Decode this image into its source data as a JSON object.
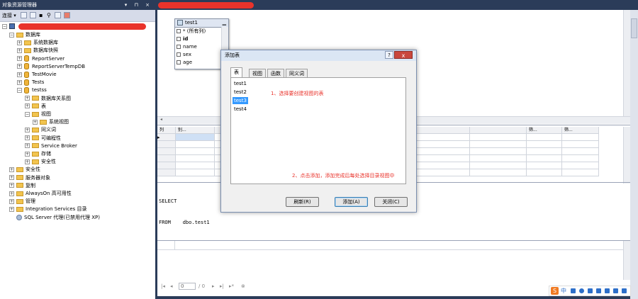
{
  "explorer": {
    "title": "对象资源管理器",
    "title_buttons": "▾ ⊓ ×",
    "connect_label": "连接 ▾",
    "tree": [
      {
        "label": "数据库",
        "icon": "folder",
        "exp": "−",
        "level": 1
      },
      {
        "label": "系统数据库",
        "icon": "folder",
        "exp": "+",
        "level": 2
      },
      {
        "label": "数据库快照",
        "icon": "folder",
        "exp": "+",
        "level": 2
      },
      {
        "label": "ReportServer",
        "icon": "db",
        "exp": "+",
        "level": 2
      },
      {
        "label": "ReportServerTempDB",
        "icon": "db",
        "exp": "+",
        "level": 2
      },
      {
        "label": "TestMovie",
        "icon": "db",
        "exp": "+",
        "level": 2
      },
      {
        "label": "Tests",
        "icon": "db",
        "exp": "+",
        "level": 2
      },
      {
        "label": "testss",
        "icon": "db",
        "exp": "−",
        "level": 2
      },
      {
        "label": "数据库关系图",
        "icon": "folder",
        "exp": "+",
        "level": 3
      },
      {
        "label": "表",
        "icon": "folder",
        "exp": "+",
        "level": 3
      },
      {
        "label": "视图",
        "icon": "folder",
        "exp": "−",
        "level": 3
      },
      {
        "label": "系统视图",
        "icon": "folder",
        "exp": "+",
        "level": 4
      },
      {
        "label": "同义词",
        "icon": "folder",
        "exp": "+",
        "level": 3
      },
      {
        "label": "可编程性",
        "icon": "folder",
        "exp": "+",
        "level": 3
      },
      {
        "label": "Service Broker",
        "icon": "folder",
        "exp": "+",
        "level": 3
      },
      {
        "label": "存储",
        "icon": "folder",
        "exp": "+",
        "level": 3
      },
      {
        "label": "安全性",
        "icon": "folder",
        "exp": "+",
        "level": 3
      },
      {
        "label": "安全性",
        "icon": "folder",
        "exp": "+",
        "level": 1
      },
      {
        "label": "服务器对象",
        "icon": "folder",
        "exp": "+",
        "level": 1
      },
      {
        "label": "复制",
        "icon": "folder",
        "exp": "+",
        "level": 1
      },
      {
        "label": "AlwaysOn 高可用性",
        "icon": "folder",
        "exp": "+",
        "level": 1
      },
      {
        "label": "管理",
        "icon": "folder",
        "exp": "+",
        "level": 1
      },
      {
        "label": "Integration Services 目录",
        "icon": "folder",
        "exp": "+",
        "level": 1
      },
      {
        "label": "SQL Server 代理(已禁用代理 XP)",
        "icon": "agent",
        "exp": "",
        "level": 1
      }
    ]
  },
  "diagram": {
    "table_name": "test1",
    "columns": [
      "* (所有列)",
      "id",
      "name",
      "sex",
      "age"
    ]
  },
  "grid": {
    "headers": [
      "列",
      "别...",
      "",
      "",
      "",
      "",
      "",
      "",
      "筛...",
      "筛..."
    ]
  },
  "sql": {
    "line1": "SELECT",
    "line2": "FROM    dbo.test1"
  },
  "nav": {
    "page_value": "0",
    "page_total": "/ 0"
  },
  "dialog": {
    "title": "添加表",
    "help": "?",
    "close": "x",
    "tabs": [
      "表",
      "视图",
      "函数",
      "同义词"
    ],
    "items": [
      "test1",
      "test2",
      "test3",
      "test4"
    ],
    "selected_index": 2,
    "annotation1": "1、选择要创建视图的表",
    "annotation2": "2、点击添加，添加完成后每处选择目录视图中",
    "buttons": {
      "refresh": "刷新(R)",
      "add": "添加(A)",
      "close": "关闭(C)"
    }
  },
  "ime": {
    "logo": "S",
    "lang": "中"
  }
}
